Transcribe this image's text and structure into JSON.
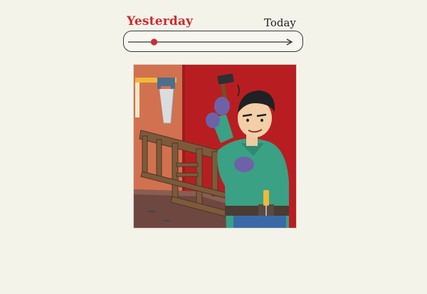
{
  "timeline": {
    "start_label": "Yesterday",
    "end_label": "Today",
    "selected_position": 0.16,
    "accent_color": "#cf2a2f"
  },
  "illustration": {
    "subject": "carpenter-repairing-chair",
    "colors": {
      "wall_left": "#d2714f",
      "wall_right": "#b81e21",
      "bench": "#6d4740",
      "shirt": "#3aa184",
      "gloves": "#6d62a8",
      "wood": "#7d5a3c"
    }
  }
}
